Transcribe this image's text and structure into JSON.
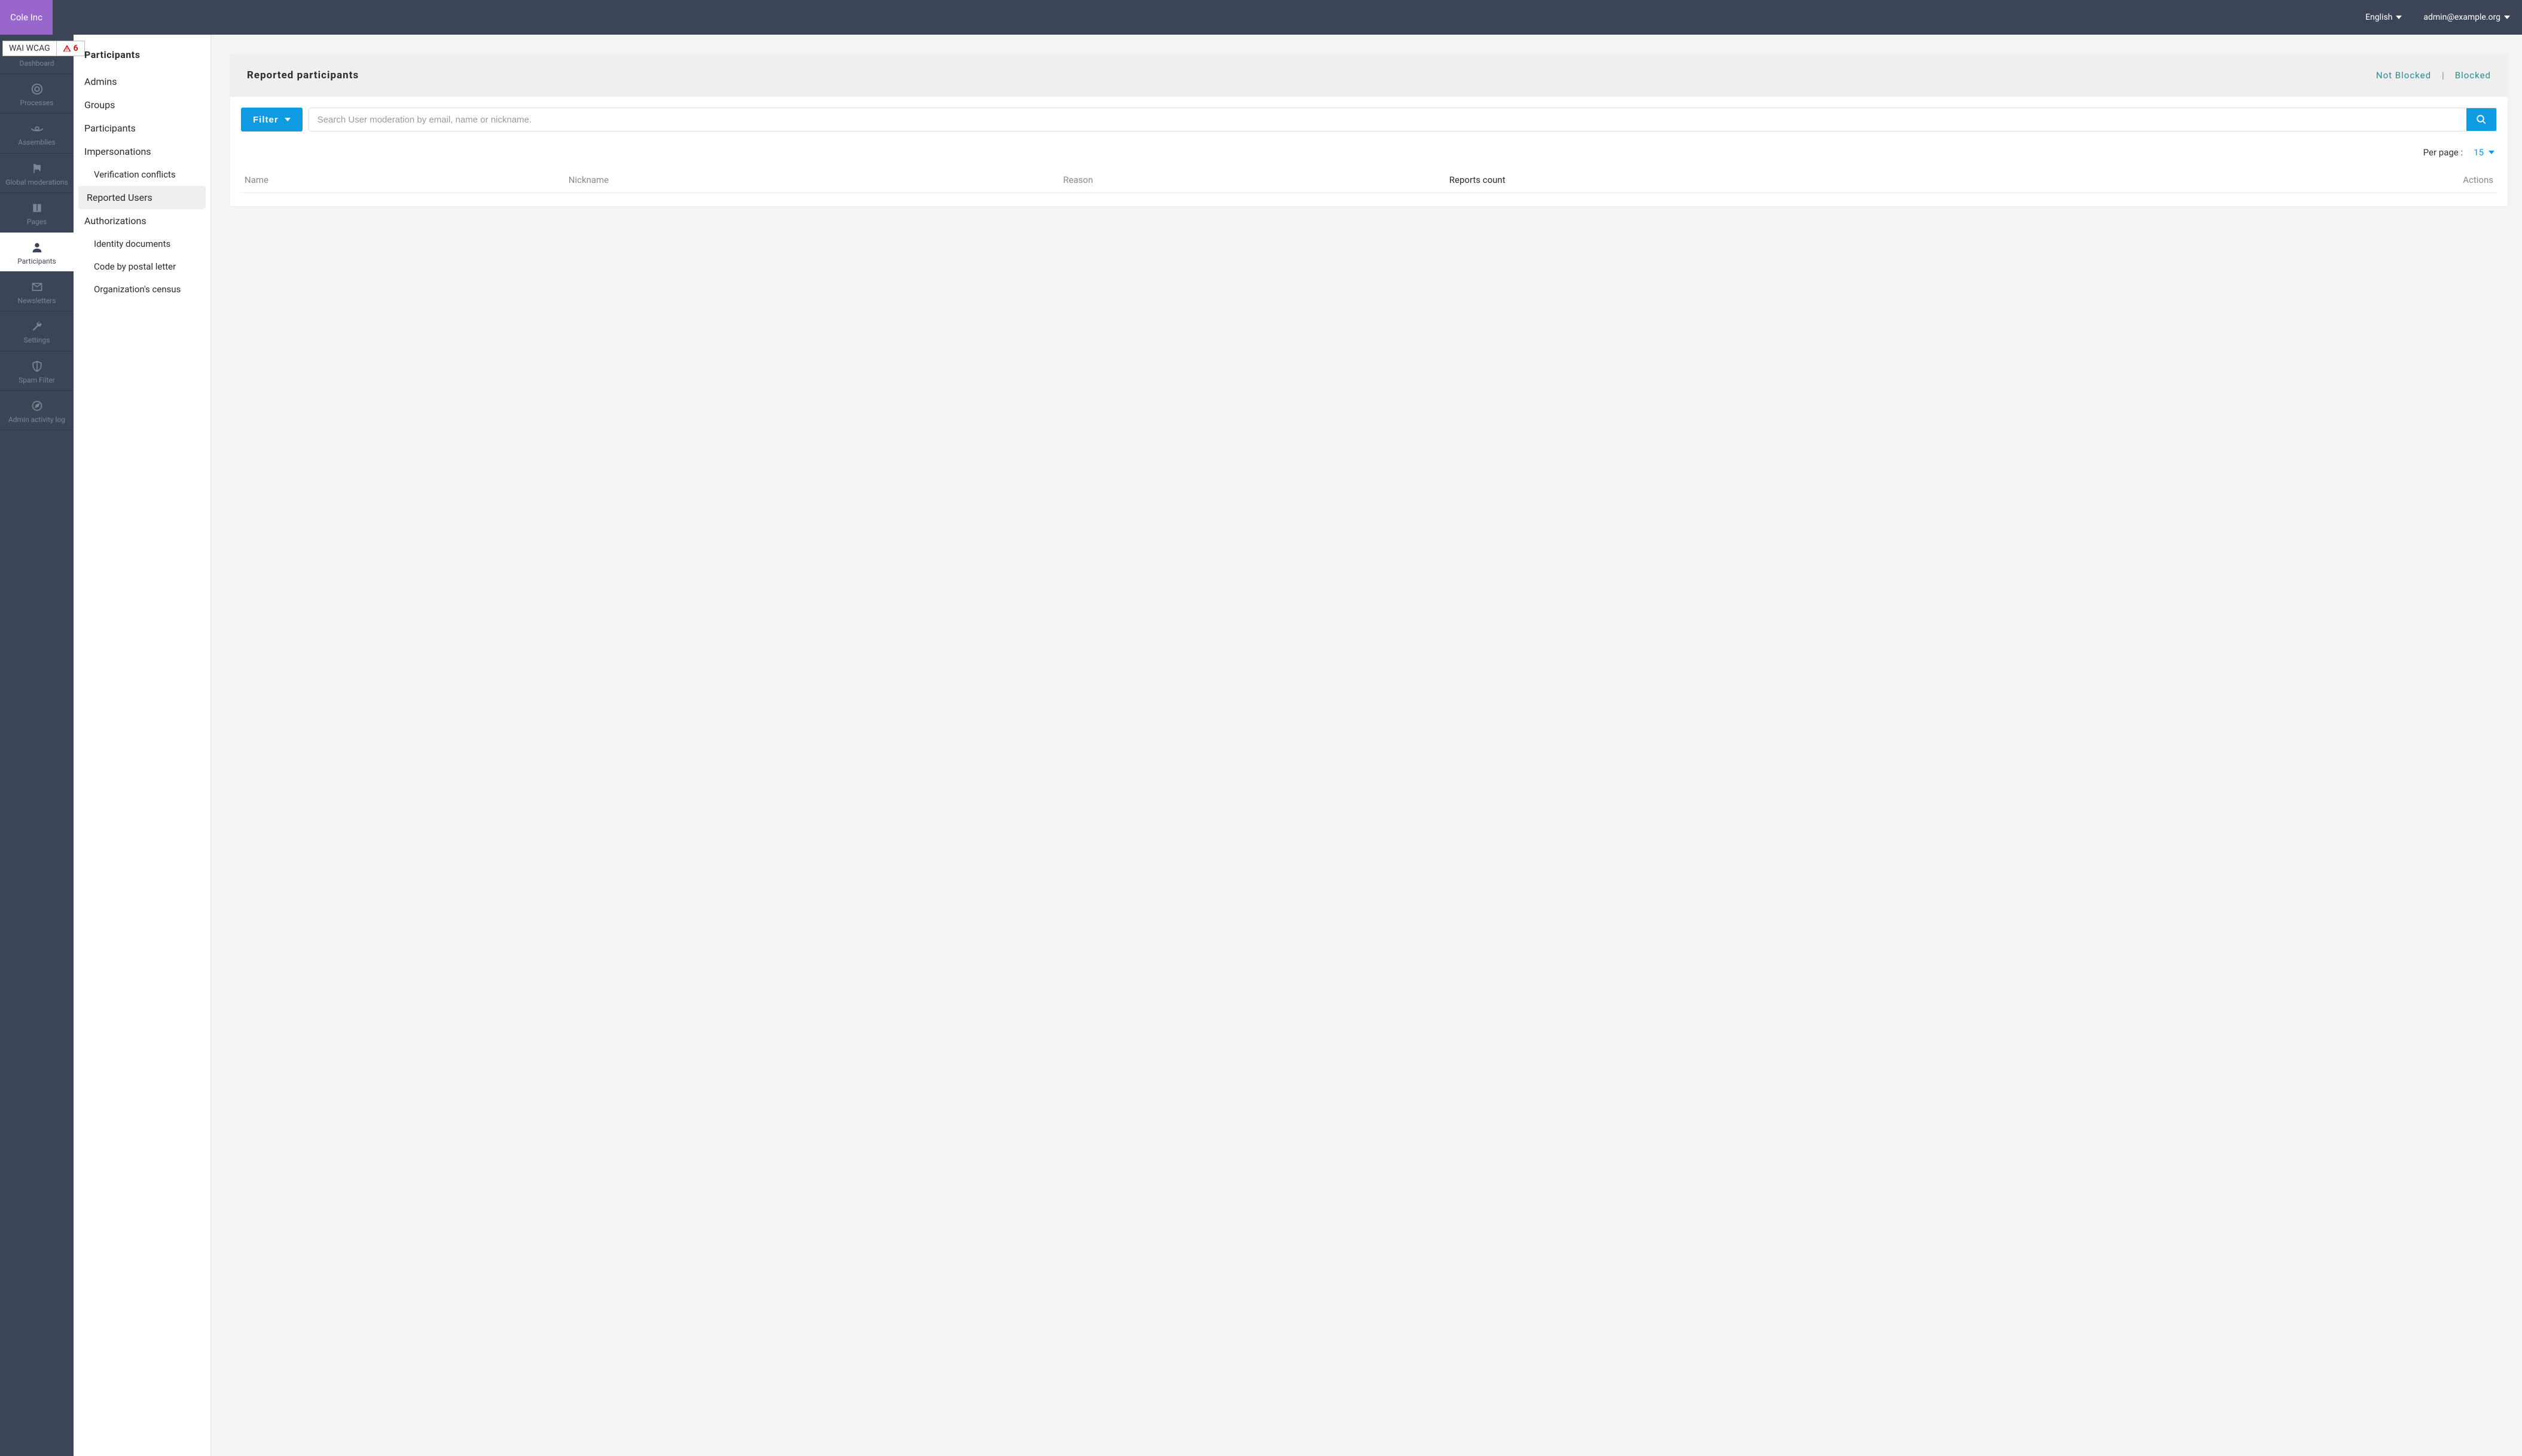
{
  "brand": "Cole Inc",
  "top": {
    "language": "English",
    "user": "admin@example.org"
  },
  "wcag": {
    "label": "WAI WCAG",
    "count": "6"
  },
  "sidebar_primary": {
    "items": [
      {
        "label": "Dashboard",
        "icon": "speedometer"
      },
      {
        "label": "Processes",
        "icon": "target"
      },
      {
        "label": "Assemblies",
        "icon": "orbit"
      },
      {
        "label": "Global moderations",
        "icon": "flag"
      },
      {
        "label": "Pages",
        "icon": "book"
      },
      {
        "label": "Participants",
        "icon": "person"
      },
      {
        "label": "Newsletters",
        "icon": "envelope"
      },
      {
        "label": "Settings",
        "icon": "wrench"
      },
      {
        "label": "Spam Filter",
        "icon": "shield"
      },
      {
        "label": "Admin activity log",
        "icon": "compass"
      }
    ],
    "active_index": 5
  },
  "sidebar_secondary": {
    "title": "Participants",
    "items": [
      {
        "label": "Admins",
        "sub": false
      },
      {
        "label": "Groups",
        "sub": false
      },
      {
        "label": "Participants",
        "sub": false
      },
      {
        "label": "Impersonations",
        "sub": false
      },
      {
        "label": "Verification conflicts",
        "sub": true
      },
      {
        "label": "Reported Users",
        "sub": false,
        "active": true
      },
      {
        "label": "Authorizations",
        "sub": false
      },
      {
        "label": "Identity documents",
        "sub": true
      },
      {
        "label": "Code by postal letter",
        "sub": true
      },
      {
        "label": "Organization's census",
        "sub": true
      }
    ]
  },
  "main": {
    "title": "Reported participants",
    "links": {
      "not_blocked": "Not Blocked",
      "blocked": "Blocked"
    },
    "filter_btn": "Filter",
    "search_placeholder": "Search User moderation by email, name or nickname.",
    "per_page_label": "Per page :",
    "per_page_value": "15",
    "columns": {
      "name": "Name",
      "nickname": "Nickname",
      "reason": "Reason",
      "reports_count": "Reports count",
      "actions": "Actions"
    }
  }
}
